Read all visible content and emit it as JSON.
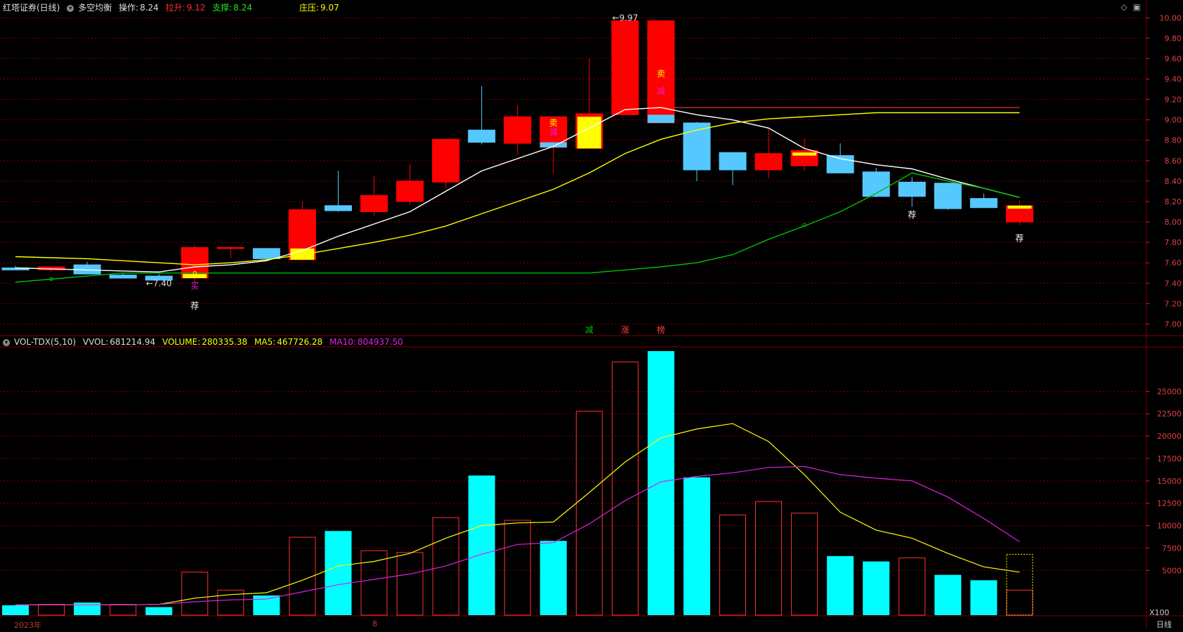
{
  "header": {
    "title": "红塔证券(日线)",
    "indicator": "多空均衡",
    "op_label": "操作:",
    "op_value": "8.24",
    "pull_label": "拉升:",
    "pull_value": "9.12",
    "support_label": "支撑:",
    "support_value": "8.24",
    "zhuang_label": "庄压:",
    "zhuang_value": "9.07"
  },
  "vol_header": {
    "name": "VOL-TDX(5,10)",
    "vvol_label": "VVOL:",
    "vvol_value": "681214.94",
    "volume_label": "VOLUME:",
    "volume_value": "280335.38",
    "ma5_label": "MA5:",
    "ma5_value": "467726.28",
    "ma10_label": "MA10:",
    "ma10_value": "804937.50"
  },
  "x_labels": [
    "2023年",
    "8"
  ],
  "corner_labels": {
    "period": "日线",
    "scale": "X100"
  },
  "colors": {
    "up": "#ff0000",
    "down": "#55c8ff",
    "cyan": "#00ffff",
    "yellow": "#ffff00",
    "white": "#ffffff",
    "green": "#00c000",
    "magenta": "#e020e0",
    "grid": "#7a0000"
  },
  "chart_data": [
    {
      "type": "candlestick",
      "title": "红塔证券(日线)",
      "ylim": [
        6.9,
        10.05
      ],
      "yticks": [
        "7.00",
        "7.20",
        "7.40",
        "7.60",
        "7.80",
        "8.00",
        "8.20",
        "8.40",
        "8.60",
        "8.80",
        "9.00",
        "9.20",
        "9.40",
        "9.60",
        "9.80",
        "10.00"
      ],
      "candles": [
        {
          "o": 7.55,
          "h": 7.57,
          "l": 7.53,
          "c": 7.53
        },
        {
          "o": 7.53,
          "h": 7.56,
          "l": 7.51,
          "c": 7.56
        },
        {
          "o": 7.58,
          "h": 7.61,
          "l": 7.49,
          "c": 7.49
        },
        {
          "o": 7.48,
          "h": 7.5,
          "l": 7.45,
          "c": 7.45
        },
        {
          "o": 7.47,
          "h": 7.49,
          "l": 7.43,
          "c": 7.43
        },
        {
          "o": 7.45,
          "h": 7.77,
          "l": 7.4,
          "c": 7.75
        },
        {
          "o": 7.75,
          "h": 7.76,
          "l": 7.65,
          "c": 7.75
        },
        {
          "o": 7.74,
          "h": 7.74,
          "l": 7.64,
          "c": 7.64
        },
        {
          "o": 7.63,
          "h": 8.2,
          "l": 7.62,
          "c": 8.12
        },
        {
          "o": 8.16,
          "h": 8.5,
          "l": 8.1,
          "c": 8.11
        },
        {
          "o": 8.1,
          "h": 8.45,
          "l": 8.06,
          "c": 8.26
        },
        {
          "o": 8.2,
          "h": 8.57,
          "l": 8.17,
          "c": 8.4
        },
        {
          "o": 8.39,
          "h": 8.81,
          "l": 8.33,
          "c": 8.81
        },
        {
          "o": 8.9,
          "h": 9.33,
          "l": 8.76,
          "c": 8.78
        },
        {
          "o": 8.77,
          "h": 9.14,
          "l": 8.66,
          "c": 9.03
        },
        {
          "o": 8.73,
          "h": 9.03,
          "l": 8.47,
          "c": 9.03
        },
        {
          "o": 8.72,
          "h": 9.6,
          "l": 8.72,
          "c": 9.06
        },
        {
          "o": 9.05,
          "h": 9.97,
          "l": 9.05,
          "c": 9.97
        },
        {
          "o": 8.97,
          "h": 9.97,
          "l": 8.96,
          "c": 9.97
        },
        {
          "o": 8.97,
          "h": 8.98,
          "l": 8.4,
          "c": 8.51
        },
        {
          "o": 8.68,
          "h": 8.68,
          "l": 8.36,
          "c": 8.51
        },
        {
          "o": 8.51,
          "h": 8.91,
          "l": 8.43,
          "c": 8.67
        },
        {
          "o": 8.55,
          "h": 8.82,
          "l": 8.5,
          "c": 8.7
        },
        {
          "o": 8.65,
          "h": 8.77,
          "l": 8.48,
          "c": 8.48
        },
        {
          "o": 8.49,
          "h": 8.53,
          "l": 8.24,
          "c": 8.25
        },
        {
          "o": 8.39,
          "h": 8.44,
          "l": 8.15,
          "c": 8.25
        },
        {
          "o": 8.38,
          "h": 8.38,
          "l": 8.12,
          "c": 8.13
        },
        {
          "o": 8.23,
          "h": 8.28,
          "l": 8.14,
          "c": 8.14
        },
        {
          "o": 8.0,
          "h": 8.21,
          "l": 7.97,
          "c": 8.16
        }
      ],
      "lines": [
        {
          "name": "white",
          "color": "#ffffff",
          "values": [
            7.55,
            7.54,
            7.53,
            7.52,
            7.51,
            7.56,
            7.58,
            7.62,
            7.72,
            7.86,
            7.98,
            8.1,
            8.3,
            8.5,
            8.62,
            8.74,
            8.92,
            9.1,
            9.12,
            9.05,
            9.0,
            8.92,
            8.72,
            8.62,
            8.56,
            8.52,
            8.42,
            8.33,
            8.24
          ]
        },
        {
          "name": "yellow",
          "color": "#ffff00",
          "values": [
            7.66,
            7.65,
            7.64,
            7.62,
            7.6,
            7.58,
            7.6,
            7.63,
            7.68,
            7.74,
            7.8,
            7.87,
            7.96,
            8.08,
            8.2,
            8.32,
            8.48,
            8.67,
            8.81,
            8.9,
            8.97,
            9.01,
            9.03,
            9.05,
            9.07,
            9.07,
            9.07,
            9.07,
            9.07
          ]
        },
        {
          "name": "green",
          "color": "#00c000",
          "values": [
            7.41,
            7.44,
            7.47,
            7.5,
            7.5,
            7.5,
            7.5,
            7.5,
            7.5,
            7.5,
            7.5,
            7.5,
            7.5,
            7.5,
            7.5,
            7.5,
            7.5,
            7.53,
            7.56,
            7.6,
            7.68,
            7.83,
            7.96,
            8.1,
            8.28,
            8.48,
            8.4,
            8.33,
            8.24
          ]
        },
        {
          "name": "red",
          "color": "#ff3030",
          "values": [
            null,
            null,
            null,
            null,
            null,
            null,
            null,
            null,
            null,
            null,
            null,
            null,
            null,
            null,
            null,
            null,
            null,
            null,
            9.12,
            9.12,
            9.12,
            9.12,
            9.12,
            9.12,
            9.12,
            9.12,
            9.12,
            9.12,
            9.12
          ]
        }
      ],
      "annotations": [
        {
          "text": "←7.40",
          "i": 4,
          "y": 7.4,
          "color": "#dddddd"
        },
        {
          "text": "←9.97",
          "i": 17,
          "y": 10.0,
          "color": "#dddddd"
        },
        {
          "text": "荐",
          "i": 5,
          "y": 7.18,
          "color": "#ffffff"
        },
        {
          "text": "荐",
          "i": 25,
          "y": 8.07,
          "color": "#ffffff"
        },
        {
          "text": "荐",
          "i": 28,
          "y": 7.84,
          "color": "#ffffff"
        },
        {
          "text": "买",
          "i": 5,
          "y": 7.37,
          "color": "#e020e0"
        },
        {
          "text": "卖",
          "i": 15,
          "y": 8.97,
          "color": "#ffff00"
        },
        {
          "text": "减",
          "i": 15,
          "y": 8.88,
          "color": "#e020e0"
        },
        {
          "text": "卖",
          "i": 18,
          "y": 9.45,
          "color": "#ffff00"
        },
        {
          "text": "减",
          "i": 18,
          "y": 9.28,
          "color": "#e020e0"
        },
        {
          "text": "减",
          "i": 16,
          "y": 6.94,
          "color": "#00c000"
        },
        {
          "text": "涨",
          "i": 17,
          "y": 6.94,
          "color": "#ff4040"
        },
        {
          "text": "榜",
          "i": 18,
          "y": 6.94,
          "color": "#ff4040"
        }
      ]
    },
    {
      "type": "bar",
      "title": "VOL-TDX(5,10)",
      "unit": "X100",
      "ylim": [
        0,
        29500
      ],
      "yticks": [
        "5000",
        "7500",
        "10000",
        "12500",
        "15000",
        "17500",
        "20000",
        "22500",
        "25000"
      ],
      "values": [
        1100,
        1200,
        1400,
        1200,
        900,
        4800,
        2800,
        2200,
        8700,
        9400,
        7200,
        7000,
        10900,
        15600,
        10600,
        8300,
        22800,
        28300,
        29500,
        15400,
        11200,
        12700,
        11400,
        6600,
        6000,
        6400,
        4500,
        3900,
        2800
      ],
      "filled": [
        true,
        false,
        true,
        false,
        true,
        false,
        false,
        true,
        false,
        true,
        false,
        false,
        false,
        true,
        false,
        true,
        false,
        false,
        true,
        true,
        false,
        false,
        false,
        true,
        true,
        false,
        true,
        true,
        false
      ],
      "outline_extra": {
        "i": 28,
        "value": 6800,
        "color": "#ffff00"
      },
      "series": [
        {
          "name": "MA5",
          "values": [
            1150,
            1150,
            1150,
            1150,
            1200,
            1900,
            2300,
            2500,
            3900,
            5500,
            6000,
            6900,
            8600,
            10000,
            10300,
            10400,
            13700,
            17100,
            19800,
            20800,
            21400,
            19400,
            15700,
            11500,
            9500,
            8600,
            6900,
            5400,
            4800
          ]
        },
        {
          "name": "MA10",
          "values": [
            1150,
            1150,
            1150,
            1150,
            1200,
            1500,
            1700,
            1800,
            2600,
            3400,
            4000,
            4600,
            5500,
            6800,
            7900,
            8100,
            10200,
            12800,
            14900,
            15500,
            15900,
            16500,
            16600,
            15700,
            15300,
            15000,
            13200,
            10800,
            8200
          ]
        }
      ]
    }
  ]
}
